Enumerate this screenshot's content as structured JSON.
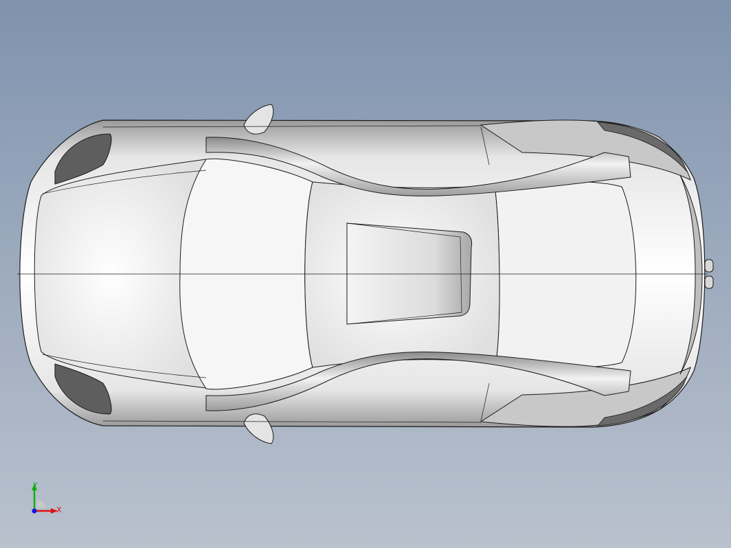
{
  "viewport": {
    "background_top": "#7f93ae",
    "background_bottom": "#b9c1cd"
  },
  "model": {
    "view": "top",
    "body_color": "#e8e8e8",
    "edge_color": "#1a1a1a"
  },
  "triad": {
    "x_label": "X",
    "y_label": "Y",
    "x_color": "#e01010",
    "y_color": "#10b010",
    "z_color": "#1010e0",
    "icon": "coordinate-triad-icon"
  }
}
